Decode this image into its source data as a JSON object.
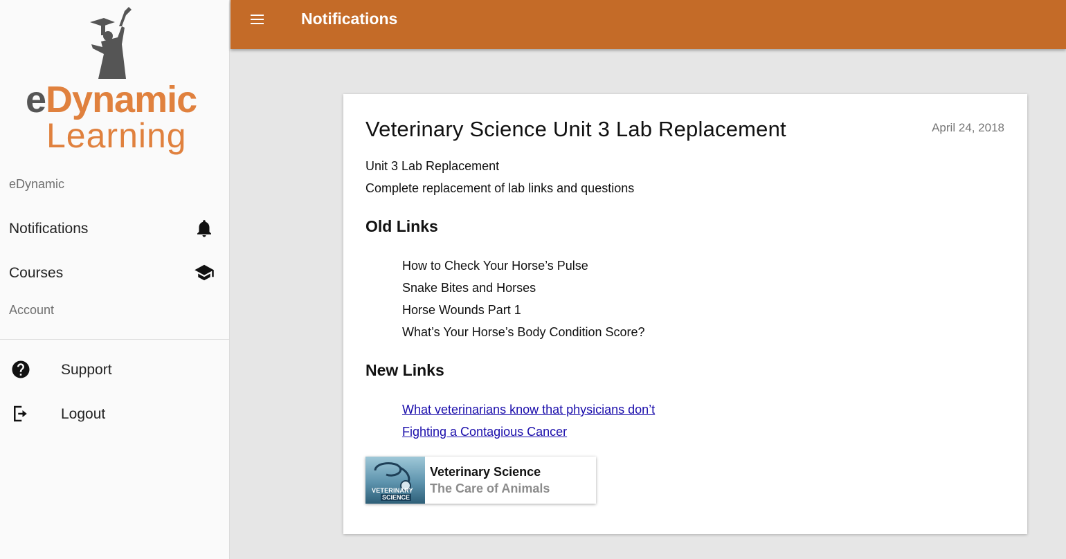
{
  "colors": {
    "brand_orange": "#c46b28",
    "logo_orange": "#e0813e",
    "link_blue": "#1a0dab"
  },
  "logo": {
    "word_e": "e",
    "word_dynamic": "Dynamic",
    "word_learning": "Learning"
  },
  "sidebar": {
    "org_name": "eDynamic",
    "nav": {
      "notifications": {
        "label": "Notifications",
        "icon": "bell-icon"
      },
      "courses": {
        "label": "Courses",
        "icon": "graduation-cap-icon"
      }
    },
    "account_label": "Account",
    "bottom": {
      "support": {
        "label": "Support",
        "icon": "help-circle-icon"
      },
      "logout": {
        "label": "Logout",
        "icon": "logout-icon"
      }
    }
  },
  "header": {
    "menu_icon": "hamburger-menu-icon",
    "title": "Notifications"
  },
  "notification": {
    "title": "Veterinary Science Unit 3 Lab Replacement",
    "date": "April 24, 2018",
    "line1": "Unit 3 Lab Replacement",
    "line2": "Complete replacement of lab links and questions",
    "old_links_heading": "Old Links",
    "old_links": [
      "How to Check Your Horse’s Pulse",
      "Snake Bites and Horses",
      "Horse Wounds Part 1",
      "What’s Your Horse’s Body Condition Score?"
    ],
    "new_links_heading": "New Links",
    "new_links": [
      "What veterinarians know that physicians don’t",
      "Fighting a Contagious Cancer"
    ],
    "course": {
      "title": "Veterinary Science",
      "subtitle": "The Care of Animals",
      "thumb_line1": "VETERINARY",
      "thumb_line2": "SCIENCE"
    }
  }
}
